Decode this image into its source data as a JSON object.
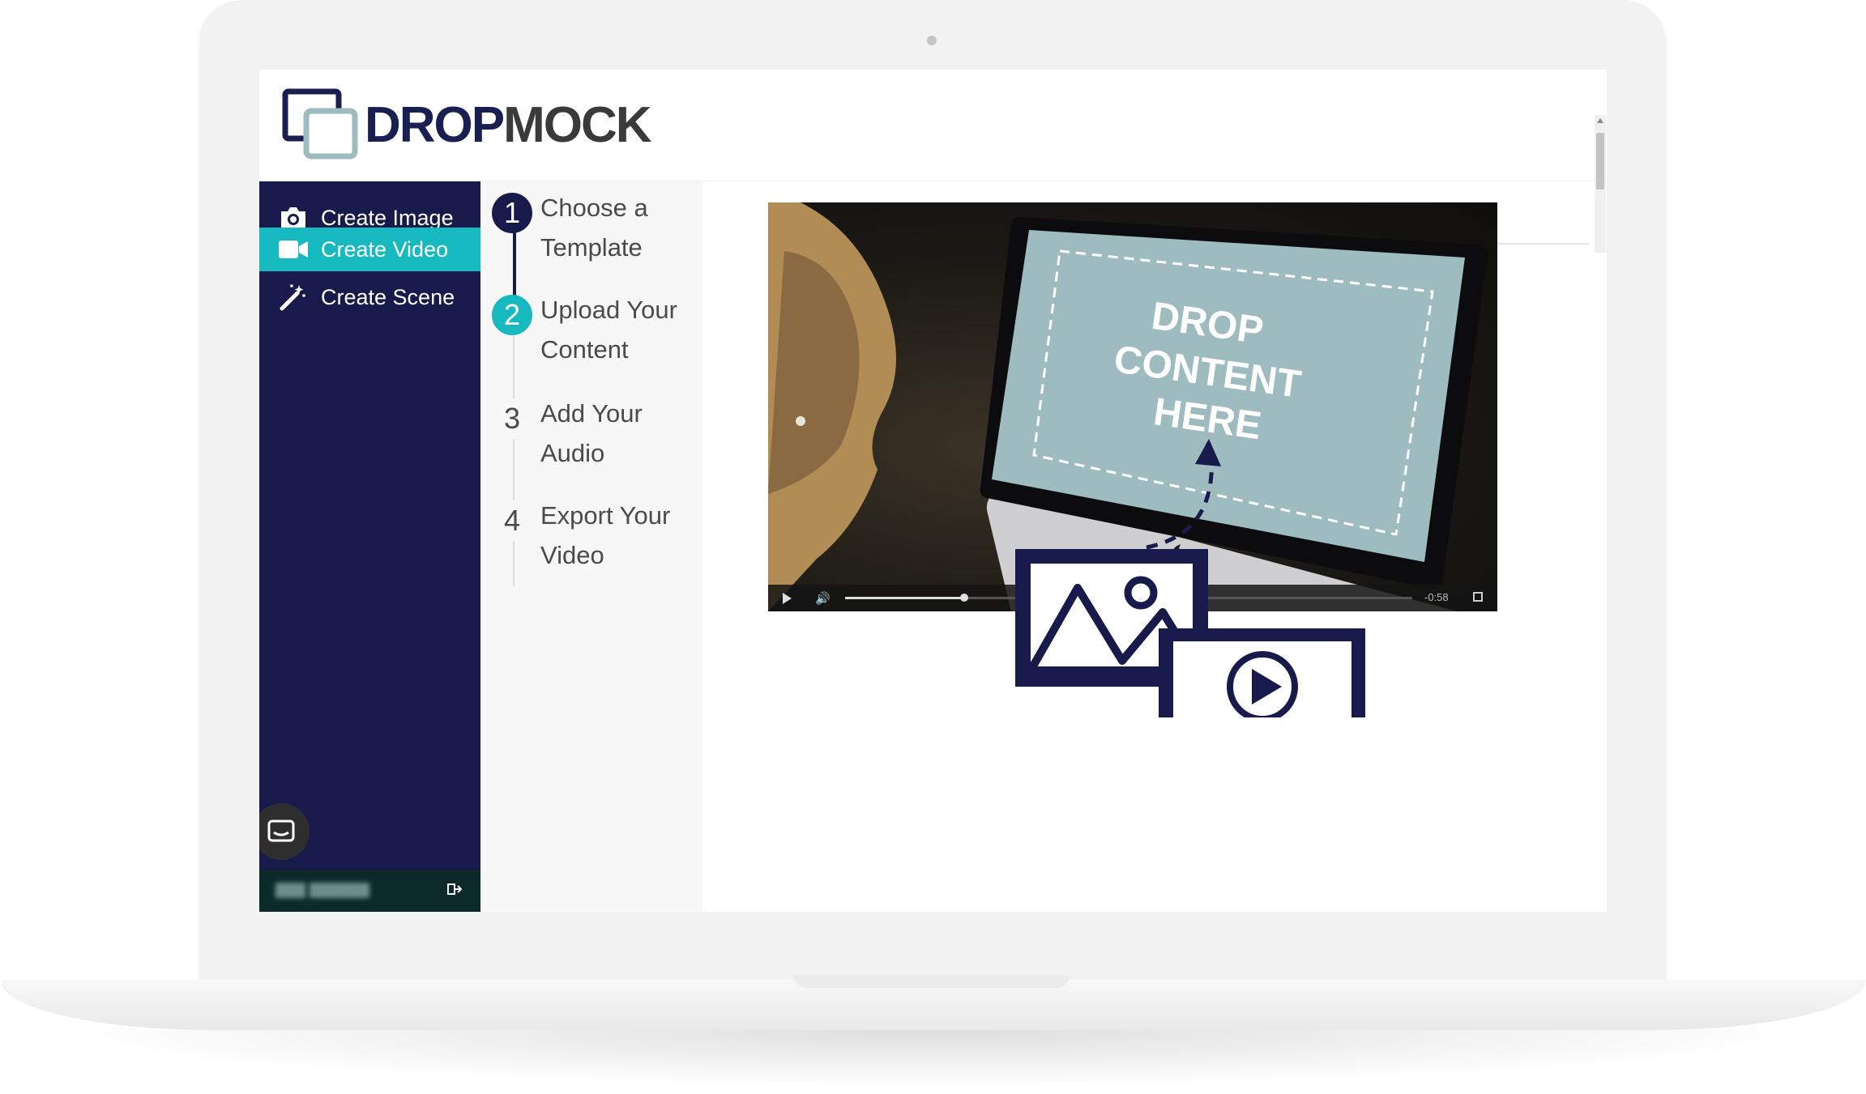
{
  "app": {
    "logo_part1": "DROP",
    "logo_part2": "MOCK",
    "colors": {
      "navy": "#171a4a",
      "teal": "#17b9c0",
      "screen_teal": "#9ebcbf"
    }
  },
  "sidebar": {
    "items": [
      {
        "label": "Create Image",
        "icon": "camera-icon",
        "active": false
      },
      {
        "label": "Create Video",
        "icon": "video-camera-icon",
        "active": true
      },
      {
        "label": "Create Scene",
        "icon": "magic-wand-icon",
        "active": false
      }
    ],
    "chat_icon": "chat-icon",
    "logout_icon": "logout-icon"
  },
  "steps": [
    {
      "number": "1",
      "line1": "Choose a",
      "line2": "Template",
      "state": "done"
    },
    {
      "number": "2",
      "line1": "Upload Your",
      "line2": "Content",
      "state": "current"
    },
    {
      "number": "3",
      "line1": "Add Your",
      "line2": "Audio",
      "state": "pending"
    },
    {
      "number": "4",
      "line1": "Export Your",
      "line2": "Video",
      "state": "pending"
    }
  ],
  "video": {
    "drop_text": [
      "DROP",
      "CONTENT",
      "HERE"
    ],
    "time_remaining": "-0:58",
    "progress": 0.21
  },
  "illustration": {
    "image_icon": "image-icon",
    "video_icon": "video-player-icon",
    "arrow": "dashed-arrow-icon"
  }
}
